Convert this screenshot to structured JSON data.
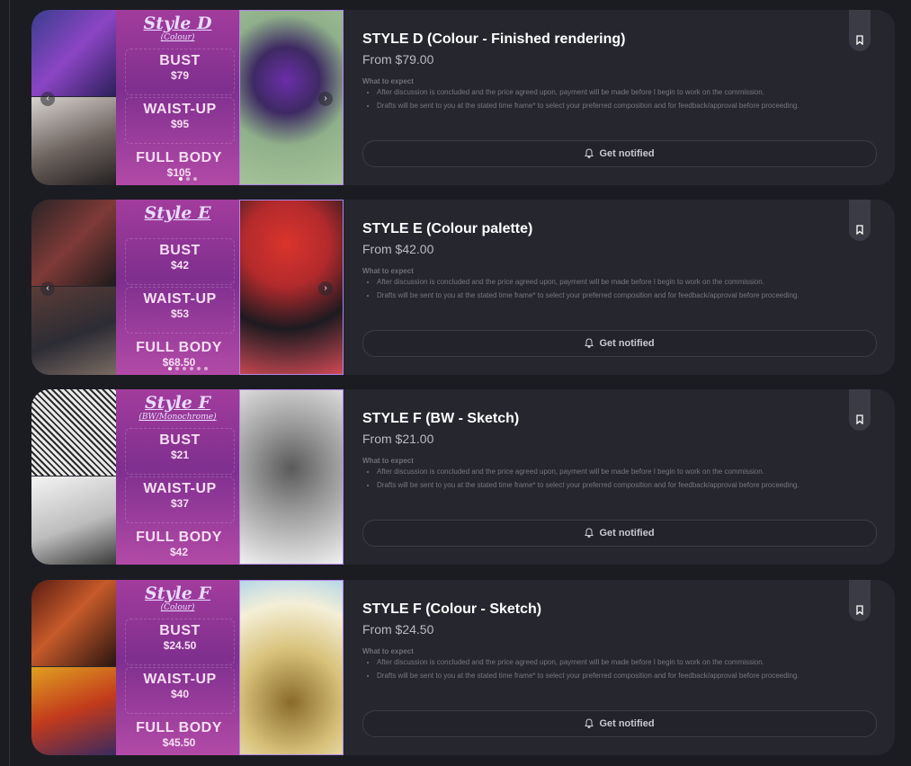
{
  "colors": {
    "bg": "#1b1c22",
    "card": "#25262e",
    "accent_border": "#b085e8",
    "price_panel": "#a23c9c"
  },
  "icons": {
    "bookmark": "bookmark-icon",
    "bell": "bell-icon",
    "prev": "chevron-left-icon",
    "next": "chevron-right-icon"
  },
  "listings": [
    {
      "title": "STYLE D (Colour - Finished rendering)",
      "price": "From $79.00",
      "expect_heading": "What to expect",
      "expect": [
        "After discussion is concluded and the price agreed upon, payment will be made before I begin to work on the commission.",
        "Drafts will be sent to you at the stated time frame* to select your preferred composition and for feedback/approval before proceeding."
      ],
      "notify_label": "Get notified",
      "sheet": {
        "title": "Style D",
        "subtitle": "(Colour)",
        "tiers": [
          {
            "name": "BUST",
            "price": "$79"
          },
          {
            "name": "WAIST-UP",
            "price": "$95"
          },
          {
            "name": "FULL BODY",
            "price": "$105"
          }
        ]
      }
    },
    {
      "title": "STYLE E (Colour palette)",
      "price": "From $42.00",
      "expect_heading": "What to expect",
      "expect": [
        "After discussion is concluded and the price agreed upon, payment will be made before I begin to work on the commission.",
        "Drafts will be sent to you at the stated time frame* to select your preferred composition and for feedback/approval before proceeding."
      ],
      "notify_label": "Get notified",
      "sheet": {
        "title": "Style E",
        "subtitle": "",
        "tiers": [
          {
            "name": "BUST",
            "price": "$42"
          },
          {
            "name": "WAIST-UP",
            "price": "$53"
          },
          {
            "name": "FULL BODY",
            "price": "$68.50"
          }
        ]
      }
    },
    {
      "title": "STYLE F (BW - Sketch)",
      "price": "From $21.00",
      "expect_heading": "What to expect",
      "expect": [
        "After discussion is concluded and the price agreed upon, payment will be made before I begin to work on the commission.",
        "Drafts will be sent to you at the stated time frame* to select your preferred composition and for feedback/approval before proceeding."
      ],
      "notify_label": "Get notified",
      "sheet": {
        "title": "Style F",
        "subtitle": "(BW/Monochrome)",
        "tiers": [
          {
            "name": "BUST",
            "price": "$21"
          },
          {
            "name": "WAIST-UP",
            "price": "$37"
          },
          {
            "name": "FULL BODY",
            "price": "$42"
          }
        ]
      }
    },
    {
      "title": "STYLE F (Colour - Sketch)",
      "price": "From $24.50",
      "expect_heading": "What to expect",
      "expect": [
        "After discussion is concluded and the price agreed upon, payment will be made before I begin to work on the commission.",
        "Drafts will be sent to you at the stated time frame* to select your preferred composition and for feedback/approval before proceeding."
      ],
      "notify_label": "Get notified",
      "sheet": {
        "title": "Style F",
        "subtitle": "(Colour)",
        "tiers": [
          {
            "name": "BUST",
            "price": "$24.50"
          },
          {
            "name": "WAIST-UP",
            "price": "$40"
          },
          {
            "name": "FULL BODY",
            "price": "$45.50"
          }
        ]
      }
    }
  ]
}
